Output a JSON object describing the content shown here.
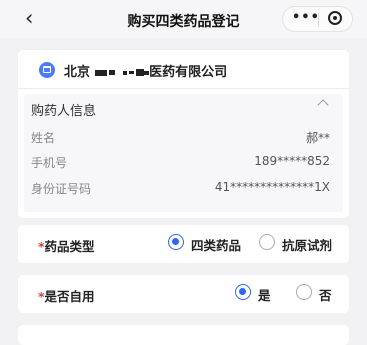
{
  "navbar": {
    "title": "购买四类药品登记",
    "back_icon": "‹",
    "more_icon": "•••"
  },
  "pharmacy": {
    "prefix": "北京",
    "suffix": "医药有限公司"
  },
  "buyer": {
    "section_title": "购药人信息",
    "rows": [
      {
        "label": "姓名",
        "value": "郝**"
      },
      {
        "label": "手机号",
        "value": "189*****852"
      },
      {
        "label": "身份证号码",
        "value": "41**************1X"
      }
    ]
  },
  "drug_type": {
    "required_mark": "*",
    "label": "药品类型",
    "options": [
      "四类药品",
      "抗原试剂"
    ],
    "selected": "四类药品"
  },
  "self_use": {
    "required_mark": "*",
    "label": "是否自用",
    "options": [
      "是",
      "否"
    ],
    "selected": "是"
  },
  "colors": {
    "accent": "#2f66f3",
    "required": "#e53935",
    "store_icon": "#4a7cf6"
  }
}
